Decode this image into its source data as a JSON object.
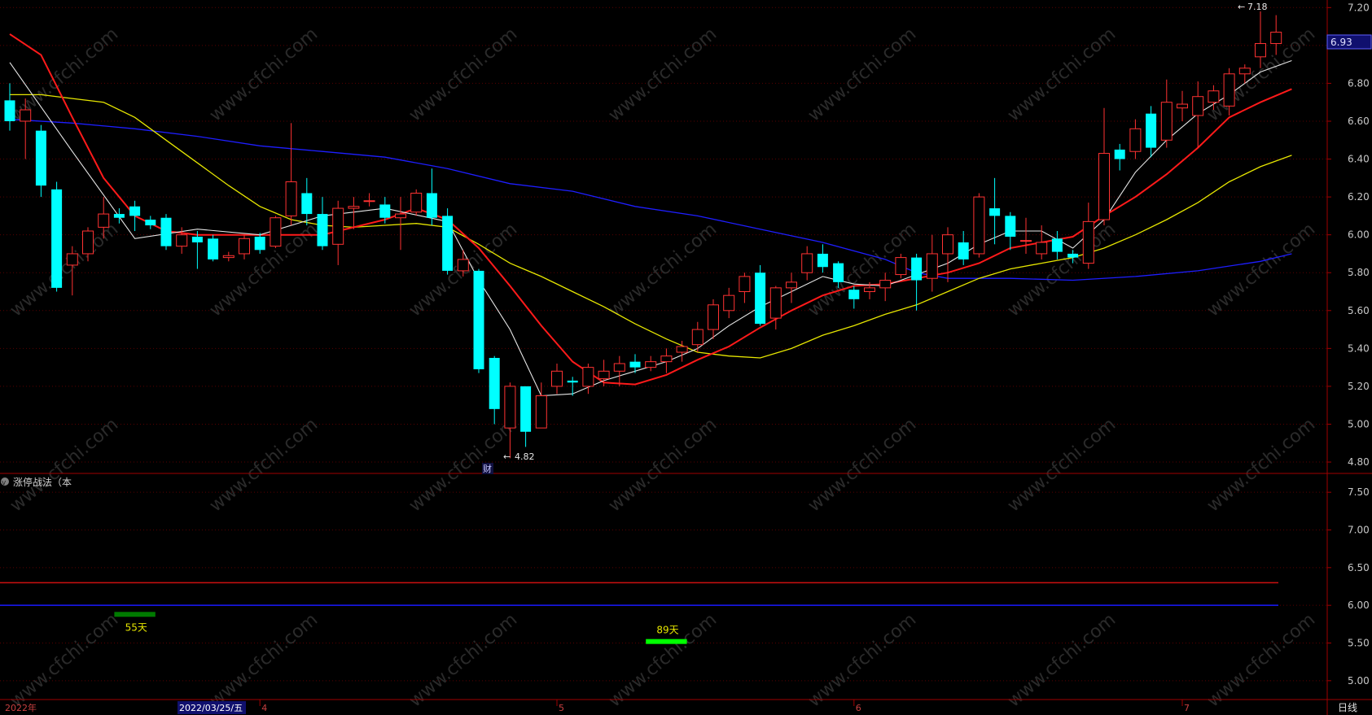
{
  "indicator_title": "涨停战法（本",
  "period_button": "日线",
  "current_price_label": "6.93",
  "high_annotation": "7.18",
  "low_annotation": "4.82",
  "report_marker": "财",
  "date_cursor_label": "2022/03/25/五",
  "watermark": "www.cfchi.com",
  "colors": {
    "up": "#ff3232",
    "down": "#00ffff",
    "ma5": "#e6e6e6",
    "ma10": "#ff1a1a",
    "ma30": "#e6e600",
    "ma60": "#1e1eff",
    "grid": "#5a0000",
    "axis": "#a00000",
    "price_box": "#10106e"
  },
  "chart_data": [
    {
      "type": "candlestick",
      "y_axis_ticks": [
        "4.80",
        "5.00",
        "5.20",
        "5.40",
        "5.60",
        "5.80",
        "6.00",
        "6.20",
        "6.40",
        "6.60",
        "6.80",
        "7.00",
        "7.20"
      ],
      "ylim": [
        4.74,
        7.24
      ],
      "x_axis_labels": [
        "2022年",
        "4",
        "5",
        "6",
        "7"
      ],
      "x_label_index": [
        0,
        16,
        35,
        54,
        75
      ],
      "candles": [
        [
          6.71,
          6.6,
          6.8,
          6.55
        ],
        [
          6.6,
          6.66,
          6.72,
          6.4
        ],
        [
          6.55,
          6.26,
          6.58,
          6.2
        ],
        [
          6.24,
          5.72,
          6.28,
          5.7
        ],
        [
          5.84,
          5.9,
          5.94,
          5.68
        ],
        [
          5.9,
          6.02,
          6.04,
          5.86
        ],
        [
          6.04,
          6.11,
          6.2,
          5.98
        ],
        [
          6.11,
          6.09,
          6.14,
          6.06
        ],
        [
          6.15,
          6.1,
          6.18,
          6.02
        ],
        [
          6.08,
          6.05,
          6.1,
          6.03
        ],
        [
          6.09,
          5.94,
          6.11,
          5.92
        ],
        [
          5.94,
          6.0,
          6.04,
          5.9
        ],
        [
          5.99,
          5.96,
          6.02,
          5.82
        ],
        [
          5.98,
          5.87,
          6.0,
          5.86
        ],
        [
          5.88,
          5.89,
          5.91,
          5.86
        ],
        [
          5.9,
          5.98,
          6.0,
          5.87
        ],
        [
          5.99,
          5.92,
          6.01,
          5.9
        ],
        [
          5.94,
          6.09,
          6.1,
          5.93
        ],
        [
          6.1,
          6.28,
          6.59,
          6.05
        ],
        [
          6.22,
          6.11,
          6.3,
          6.05
        ],
        [
          6.11,
          5.94,
          6.2,
          5.92
        ],
        [
          5.95,
          6.14,
          6.18,
          5.84
        ],
        [
          6.14,
          6.15,
          6.2,
          6.03
        ],
        [
          6.18,
          6.18,
          6.22,
          6.15
        ],
        [
          6.16,
          6.09,
          6.2,
          6.06
        ],
        [
          6.09,
          6.11,
          6.2,
          5.92
        ],
        [
          6.12,
          6.22,
          6.24,
          6.1
        ],
        [
          6.22,
          6.09,
          6.35,
          6.05
        ],
        [
          6.1,
          5.81,
          6.14,
          5.79
        ],
        [
          5.81,
          5.87,
          5.92,
          5.78
        ],
        [
          5.81,
          5.29,
          5.82,
          5.27
        ],
        [
          5.35,
          5.08,
          5.36,
          5.0
        ],
        [
          4.98,
          5.2,
          5.22,
          4.82
        ],
        [
          5.2,
          4.96,
          5.2,
          4.88
        ],
        [
          4.98,
          5.15,
          5.22,
          4.98
        ],
        [
          5.2,
          5.28,
          5.32,
          5.16
        ],
        [
          5.23,
          5.22,
          5.25,
          5.15
        ],
        [
          5.2,
          5.3,
          5.32,
          5.16
        ],
        [
          5.24,
          5.28,
          5.34,
          5.2
        ],
        [
          5.28,
          5.32,
          5.36,
          5.2
        ],
        [
          5.33,
          5.3,
          5.37,
          5.27
        ],
        [
          5.3,
          5.33,
          5.36,
          5.28
        ],
        [
          5.33,
          5.36,
          5.4,
          5.27
        ],
        [
          5.38,
          5.41,
          5.44,
          5.33
        ],
        [
          5.42,
          5.5,
          5.54,
          5.38
        ],
        [
          5.5,
          5.63,
          5.66,
          5.45
        ],
        [
          5.6,
          5.68,
          5.72,
          5.56
        ],
        [
          5.7,
          5.78,
          5.8,
          5.64
        ],
        [
          5.8,
          5.53,
          5.84,
          5.52
        ],
        [
          5.56,
          5.72,
          5.73,
          5.5
        ],
        [
          5.72,
          5.75,
          5.8,
          5.64
        ],
        [
          5.8,
          5.9,
          5.94,
          5.76
        ],
        [
          5.9,
          5.83,
          5.95,
          5.8
        ],
        [
          5.85,
          5.75,
          5.86,
          5.72
        ],
        [
          5.71,
          5.66,
          5.73,
          5.61
        ],
        [
          5.7,
          5.72,
          5.75,
          5.66
        ],
        [
          5.72,
          5.76,
          5.8,
          5.65
        ],
        [
          5.79,
          5.88,
          5.9,
          5.77
        ],
        [
          5.88,
          5.76,
          5.9,
          5.6
        ],
        [
          5.77,
          5.9,
          6.0,
          5.7
        ],
        [
          5.9,
          6.0,
          6.04,
          5.75
        ],
        [
          5.96,
          5.87,
          6.02,
          5.84
        ],
        [
          5.9,
          6.2,
          6.22,
          5.88
        ],
        [
          6.14,
          6.1,
          6.3,
          5.95
        ],
        [
          6.1,
          5.99,
          6.12,
          5.92
        ],
        [
          5.97,
          5.97,
          6.09,
          5.9
        ],
        [
          5.9,
          5.96,
          6.05,
          5.87
        ],
        [
          5.98,
          5.91,
          6.02,
          5.87
        ],
        [
          5.9,
          5.88,
          5.92,
          5.85
        ],
        [
          5.85,
          6.07,
          6.17,
          5.82
        ],
        [
          6.08,
          6.43,
          6.67,
          6.05
        ],
        [
          6.45,
          6.4,
          6.48,
          6.34
        ],
        [
          6.44,
          6.56,
          6.61,
          6.4
        ],
        [
          6.64,
          6.46,
          6.68,
          6.41
        ],
        [
          6.5,
          6.7,
          6.82,
          6.46
        ],
        [
          6.67,
          6.69,
          6.76,
          6.6
        ],
        [
          6.63,
          6.73,
          6.81,
          6.46
        ],
        [
          6.7,
          6.76,
          6.79,
          6.66
        ],
        [
          6.68,
          6.85,
          6.88,
          6.63
        ],
        [
          6.85,
          6.88,
          6.9,
          6.8
        ],
        [
          6.94,
          7.01,
          7.18,
          6.88
        ],
        [
          7.01,
          7.07,
          7.16,
          6.95
        ]
      ],
      "ma5": [
        [
          0,
          6.91
        ],
        [
          4,
          6.44
        ],
        [
          8,
          5.98
        ],
        [
          12,
          6.03
        ],
        [
          16,
          6.0
        ],
        [
          20,
          6.1
        ],
        [
          24,
          6.14
        ],
        [
          28,
          6.07
        ],
        [
          30,
          5.76
        ],
        [
          32,
          5.5
        ],
        [
          34,
          5.15
        ],
        [
          36,
          5.16
        ],
        [
          38,
          5.23
        ],
        [
          40,
          5.28
        ],
        [
          42,
          5.33
        ],
        [
          44,
          5.4
        ],
        [
          46,
          5.52
        ],
        [
          48,
          5.62
        ],
        [
          50,
          5.7
        ],
        [
          52,
          5.78
        ],
        [
          54,
          5.74
        ],
        [
          56,
          5.73
        ],
        [
          58,
          5.79
        ],
        [
          60,
          5.85
        ],
        [
          62,
          5.95
        ],
        [
          64,
          6.02
        ],
        [
          66,
          6.02
        ],
        [
          68,
          5.93
        ],
        [
          70,
          6.08
        ],
        [
          72,
          6.33
        ],
        [
          74,
          6.5
        ],
        [
          76,
          6.64
        ],
        [
          78,
          6.74
        ],
        [
          80,
          6.86
        ],
        [
          82,
          6.92
        ]
      ],
      "ma10": [
        [
          0,
          7.06
        ],
        [
          2,
          6.95
        ],
        [
          4,
          6.62
        ],
        [
          6,
          6.3
        ],
        [
          8,
          6.1
        ],
        [
          10,
          6.02
        ],
        [
          12,
          6.0
        ],
        [
          16,
          6.0
        ],
        [
          20,
          6.0
        ],
        [
          24,
          6.08
        ],
        [
          26,
          6.14
        ],
        [
          28,
          6.08
        ],
        [
          30,
          5.93
        ],
        [
          32,
          5.73
        ],
        [
          34,
          5.52
        ],
        [
          36,
          5.33
        ],
        [
          38,
          5.22
        ],
        [
          40,
          5.21
        ],
        [
          42,
          5.26
        ],
        [
          44,
          5.34
        ],
        [
          46,
          5.41
        ],
        [
          48,
          5.51
        ],
        [
          50,
          5.6
        ],
        [
          52,
          5.68
        ],
        [
          54,
          5.73
        ],
        [
          56,
          5.74
        ],
        [
          58,
          5.77
        ],
        [
          60,
          5.8
        ],
        [
          62,
          5.85
        ],
        [
          64,
          5.93
        ],
        [
          66,
          5.96
        ],
        [
          68,
          5.99
        ],
        [
          70,
          6.1
        ],
        [
          72,
          6.2
        ],
        [
          74,
          6.32
        ],
        [
          76,
          6.46
        ],
        [
          78,
          6.62
        ],
        [
          80,
          6.7
        ],
        [
          82,
          6.77
        ]
      ],
      "ma30": [
        [
          0,
          6.74
        ],
        [
          2,
          6.74
        ],
        [
          4,
          6.72
        ],
        [
          6,
          6.7
        ],
        [
          8,
          6.62
        ],
        [
          10,
          6.5
        ],
        [
          12,
          6.38
        ],
        [
          14,
          6.26
        ],
        [
          16,
          6.15
        ],
        [
          18,
          6.08
        ],
        [
          20,
          6.05
        ],
        [
          22,
          6.04
        ],
        [
          24,
          6.05
        ],
        [
          26,
          6.06
        ],
        [
          28,
          6.04
        ],
        [
          30,
          5.95
        ],
        [
          32,
          5.85
        ],
        [
          34,
          5.78
        ],
        [
          36,
          5.7
        ],
        [
          38,
          5.62
        ],
        [
          40,
          5.53
        ],
        [
          42,
          5.45
        ],
        [
          44,
          5.38
        ],
        [
          46,
          5.36
        ],
        [
          48,
          5.35
        ],
        [
          50,
          5.4
        ],
        [
          52,
          5.47
        ],
        [
          54,
          5.52
        ],
        [
          56,
          5.58
        ],
        [
          58,
          5.63
        ],
        [
          60,
          5.7
        ],
        [
          62,
          5.77
        ],
        [
          64,
          5.82
        ],
        [
          66,
          5.85
        ],
        [
          68,
          5.88
        ],
        [
          70,
          5.93
        ],
        [
          72,
          6.0
        ],
        [
          74,
          6.08
        ],
        [
          76,
          6.17
        ],
        [
          78,
          6.28
        ],
        [
          80,
          6.36
        ],
        [
          82,
          6.42
        ]
      ],
      "ma60": [
        [
          0,
          6.61
        ],
        [
          4,
          6.59
        ],
        [
          8,
          6.56
        ],
        [
          12,
          6.52
        ],
        [
          16,
          6.47
        ],
        [
          20,
          6.44
        ],
        [
          24,
          6.41
        ],
        [
          28,
          6.35
        ],
        [
          32,
          6.27
        ],
        [
          36,
          6.23
        ],
        [
          40,
          6.15
        ],
        [
          44,
          6.1
        ],
        [
          48,
          6.03
        ],
        [
          52,
          5.96
        ],
        [
          56,
          5.87
        ],
        [
          58,
          5.8
        ],
        [
          60,
          5.77
        ],
        [
          64,
          5.77
        ],
        [
          68,
          5.76
        ],
        [
          72,
          5.78
        ],
        [
          76,
          5.81
        ],
        [
          80,
          5.86
        ],
        [
          82,
          5.9
        ]
      ]
    },
    {
      "type": "line",
      "title": "涨停战法（本",
      "y_axis_ticks": [
        "5.00",
        "5.50",
        "6.00",
        "6.50",
        "7.00",
        "7.50"
      ],
      "ylim": [
        4.75,
        7.75
      ],
      "hlines": [
        {
          "value": 6.3,
          "color": "#cc1010"
        },
        {
          "value": 6.0,
          "color": "#1a1aff"
        }
      ],
      "bars": [
        {
          "from": 7,
          "to": 9,
          "value": 5.88,
          "color": "#007a00",
          "label": "55天"
        },
        {
          "from": 41,
          "to": 43,
          "value": 5.52,
          "color": "#00ff00",
          "label": "89天"
        }
      ]
    }
  ]
}
